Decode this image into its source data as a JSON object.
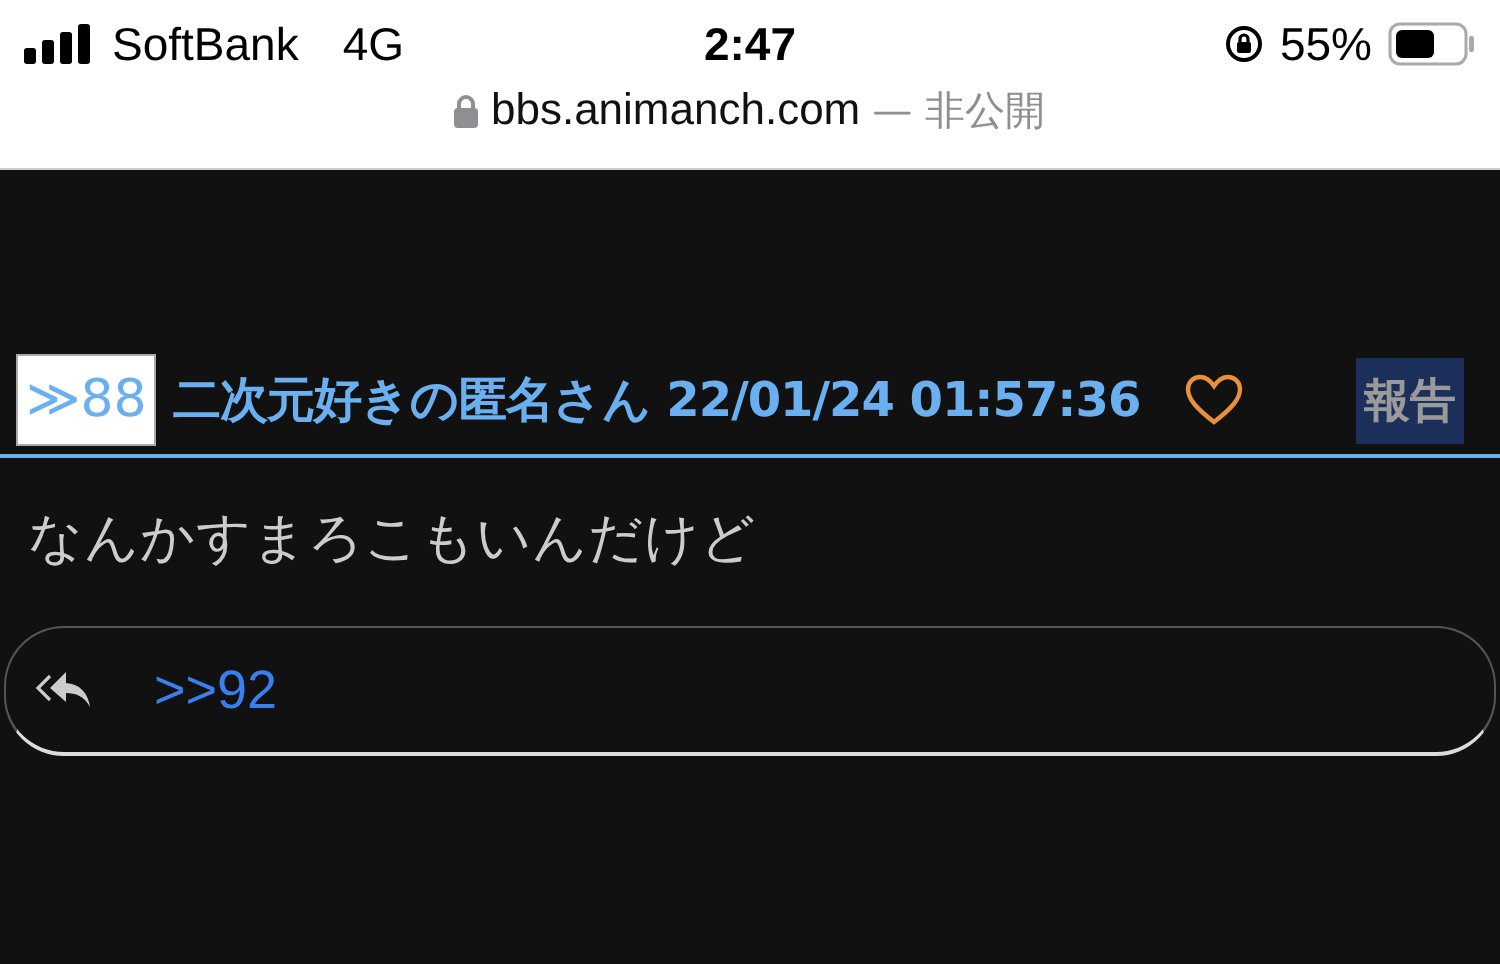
{
  "status_bar": {
    "carrier": "SoftBank",
    "network": "4G",
    "time": "2:47",
    "battery": "55%"
  },
  "address_bar": {
    "domain": "bbs.animanch.com",
    "note": "— 非公開"
  },
  "post": {
    "number": "≫88",
    "author": "二次元好きの匿名さん",
    "datetime": "22/01/24 01:57:36",
    "liked": false,
    "report": "報告",
    "body": "なんかすまろこもいんだけど"
  },
  "replies": [
    {
      "link": ">>92"
    }
  ]
}
